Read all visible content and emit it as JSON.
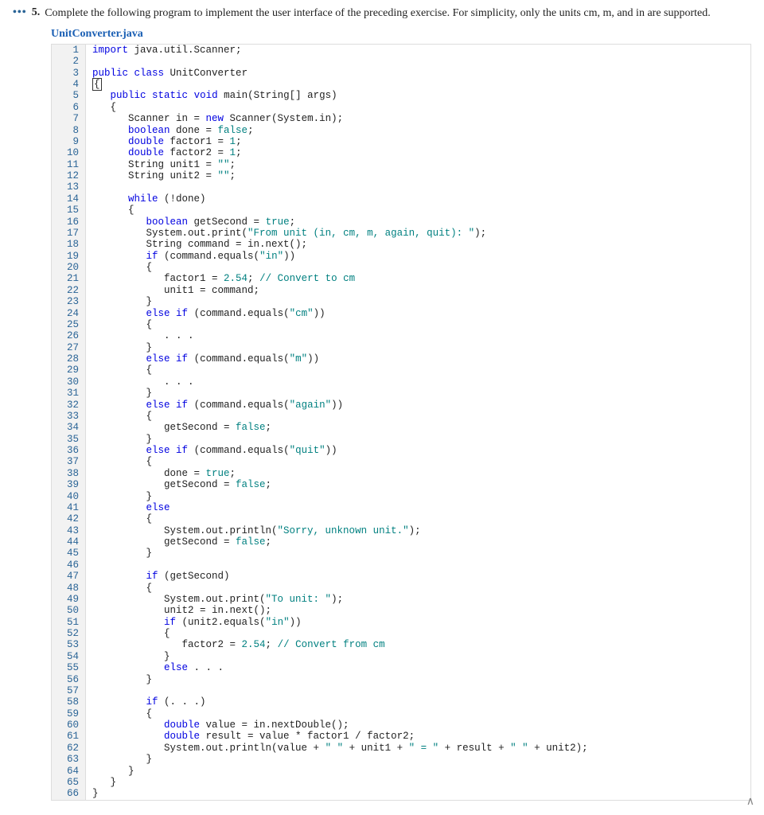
{
  "problem": {
    "dots": "•••",
    "number": "5.",
    "text": "Complete the following program to implement the user interface of the preceding exercise. For simplicity, only the units cm, m, and in are supported."
  },
  "filename": "UnitConverter.java",
  "code_lines": [
    {
      "n": 1,
      "html": "<span class='kw'>import</span> java.util.Scanner;"
    },
    {
      "n": 2,
      "html": ""
    },
    {
      "n": 3,
      "html": "<span class='kw'>public</span> <span class='kw'>class</span> UnitConverter"
    },
    {
      "n": 4,
      "html": "<span class='box'>{</span>"
    },
    {
      "n": 5,
      "html": "   <span class='kw'>public</span> <span class='kw'>static</span> <span class='type'>void</span> main(String[] args)"
    },
    {
      "n": 6,
      "html": "   {"
    },
    {
      "n": 7,
      "html": "      Scanner in = <span class='new'>new</span> Scanner(System.in);"
    },
    {
      "n": 8,
      "html": "      <span class='type'>boolean</span> done = <span class='bool'>false</span>;"
    },
    {
      "n": 9,
      "html": "      <span class='type'>double</span> factor1 = <span class='num'>1</span>;"
    },
    {
      "n": 10,
      "html": "      <span class='type'>double</span> factor2 = <span class='num'>1</span>;"
    },
    {
      "n": 11,
      "html": "      String unit1 = <span class='str'>\"\"</span>;"
    },
    {
      "n": 12,
      "html": "      String unit2 = <span class='str'>\"\"</span>;"
    },
    {
      "n": 13,
      "html": ""
    },
    {
      "n": 14,
      "html": "      <span class='kw'>while</span> (!done)"
    },
    {
      "n": 15,
      "html": "      {"
    },
    {
      "n": 16,
      "html": "         <span class='type'>boolean</span> getSecond = <span class='bool'>true</span>;"
    },
    {
      "n": 17,
      "html": "         System.out.print(<span class='str'>\"From unit (in, cm, m, again, quit): \"</span>);"
    },
    {
      "n": 18,
      "html": "         String command = in.next();"
    },
    {
      "n": 19,
      "html": "         <span class='kw'>if</span> (command.equals(<span class='str'>\"in\"</span>))"
    },
    {
      "n": 20,
      "html": "         {"
    },
    {
      "n": 21,
      "html": "            factor1 = <span class='num'>2.54</span>; <span class='cmt'>// Convert to cm</span>"
    },
    {
      "n": 22,
      "html": "            unit1 = command;"
    },
    {
      "n": 23,
      "html": "         }"
    },
    {
      "n": 24,
      "html": "         <span class='kw'>else</span> <span class='kw'>if</span> (command.equals(<span class='str'>\"cm\"</span>))"
    },
    {
      "n": 25,
      "html": "         {"
    },
    {
      "n": 26,
      "html": "            . . ."
    },
    {
      "n": 27,
      "html": "         }"
    },
    {
      "n": 28,
      "html": "         <span class='kw'>else</span> <span class='kw'>if</span> (command.equals(<span class='str'>\"m\"</span>))"
    },
    {
      "n": 29,
      "html": "         {"
    },
    {
      "n": 30,
      "html": "            . . ."
    },
    {
      "n": 31,
      "html": "         }"
    },
    {
      "n": 32,
      "html": "         <span class='kw'>else</span> <span class='kw'>if</span> (command.equals(<span class='str'>\"again\"</span>))"
    },
    {
      "n": 33,
      "html": "         {"
    },
    {
      "n": 34,
      "html": "            getSecond = <span class='bool'>false</span>;"
    },
    {
      "n": 35,
      "html": "         }"
    },
    {
      "n": 36,
      "html": "         <span class='kw'>else</span> <span class='kw'>if</span> (command.equals(<span class='str'>\"quit\"</span>))"
    },
    {
      "n": 37,
      "html": "         {"
    },
    {
      "n": 38,
      "html": "            done = <span class='bool'>true</span>;"
    },
    {
      "n": 39,
      "html": "            getSecond = <span class='bool'>false</span>;"
    },
    {
      "n": 40,
      "html": "         }"
    },
    {
      "n": 41,
      "html": "         <span class='kw'>else</span>"
    },
    {
      "n": 42,
      "html": "         {"
    },
    {
      "n": 43,
      "html": "            System.out.println(<span class='str'>\"Sorry, unknown unit.\"</span>);"
    },
    {
      "n": 44,
      "html": "            getSecond = <span class='bool'>false</span>;"
    },
    {
      "n": 45,
      "html": "         }"
    },
    {
      "n": 46,
      "html": ""
    },
    {
      "n": 47,
      "html": "         <span class='kw'>if</span> (getSecond)"
    },
    {
      "n": 48,
      "html": "         {"
    },
    {
      "n": 49,
      "html": "            System.out.print(<span class='str'>\"To unit: \"</span>);"
    },
    {
      "n": 50,
      "html": "            unit2 = in.next();"
    },
    {
      "n": 51,
      "html": "            <span class='kw'>if</span> (unit2.equals(<span class='str'>\"in\"</span>))"
    },
    {
      "n": 52,
      "html": "            {"
    },
    {
      "n": 53,
      "html": "               factor2 = <span class='num'>2.54</span>; <span class='cmt'>// Convert from cm</span>"
    },
    {
      "n": 54,
      "html": "            }"
    },
    {
      "n": 55,
      "html": "            <span class='kw'>else</span> . . ."
    },
    {
      "n": 56,
      "html": "         }"
    },
    {
      "n": 57,
      "html": ""
    },
    {
      "n": 58,
      "html": "         <span class='kw'>if</span> (. . .)"
    },
    {
      "n": 59,
      "html": "         {"
    },
    {
      "n": 60,
      "html": "            <span class='type'>double</span> value = in.nextDouble();"
    },
    {
      "n": 61,
      "html": "            <span class='type'>double</span> result = value * factor1 / factor2;"
    },
    {
      "n": 62,
      "html": "            System.out.println(value + <span class='str'>\" \"</span> + unit1 + <span class='str'>\" = \"</span> + result + <span class='str'>\" \"</span> + unit2);"
    },
    {
      "n": 63,
      "html": "         }"
    },
    {
      "n": 64,
      "html": "      }"
    },
    {
      "n": 65,
      "html": "   }"
    },
    {
      "n": 66,
      "html": "}"
    }
  ],
  "chevron": "∧"
}
